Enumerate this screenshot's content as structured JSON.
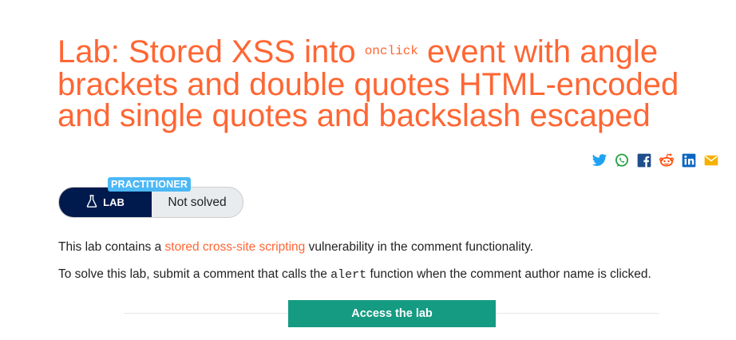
{
  "title": {
    "part1": "Lab: Stored XSS into ",
    "code": "onclick",
    "part2": " event with angle brackets and double quotes HTML-encoded and single quotes and backslash escaped"
  },
  "share_icons": [
    "twitter-icon",
    "whatsapp-icon",
    "facebook-icon",
    "reddit-icon",
    "linkedin-icon",
    "email-icon"
  ],
  "level": "PRACTITIONER",
  "lab_label": "LAB",
  "status": "Not solved",
  "description": {
    "line1_before": "This lab contains a ",
    "line1_link": "stored cross-site scripting",
    "line1_after": " vulnerability in the comment functionality.",
    "line2_before": "To solve this lab, submit a comment that calls the ",
    "line2_code": "alert",
    "line2_after": " function when the comment author name is clicked."
  },
  "access_button": "Access the lab",
  "colors": {
    "accent": "#ff6633",
    "badge": "#4cb8f5",
    "lab_dark": "#001a4d",
    "button": "#159b82"
  }
}
